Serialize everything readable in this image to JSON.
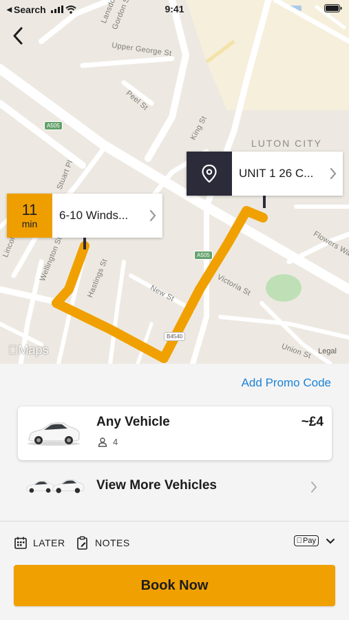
{
  "status_bar": {
    "back_app": "Search",
    "time": "9:41"
  },
  "map": {
    "streets": [
      "Upper George St",
      "Peel St",
      "King St",
      "Stuart Pl",
      "Wellington St",
      "Hastings St",
      "New St",
      "Victoria St",
      "Union St",
      "Flowers Wa",
      "Gordon St",
      "Lansdowne",
      "Lincoln"
    ],
    "area_label": "LUTON CITY",
    "road_shields": [
      "A505",
      "A505",
      "B4540"
    ],
    "pickup": {
      "eta_value": "11",
      "eta_unit": "min",
      "address": "6-10 Winds..."
    },
    "dropoff": {
      "address": "UNIT 1 26 C..."
    },
    "attribution": "Maps",
    "legal": "Legal",
    "route_color": "#F0A000"
  },
  "panel": {
    "promo_label": "Add Promo Code",
    "vehicle": {
      "name": "Any Vehicle",
      "seats": "4",
      "price": "~£4"
    },
    "more_vehicles_label": "View More Vehicles",
    "options": {
      "later_label": "LATER",
      "notes_label": "NOTES",
      "payment_label": "Pay"
    },
    "book_label": "Book Now"
  },
  "colors": {
    "accent": "#F0A000",
    "link": "#1C82D6",
    "dark_pin": "#2B2B3A"
  }
}
